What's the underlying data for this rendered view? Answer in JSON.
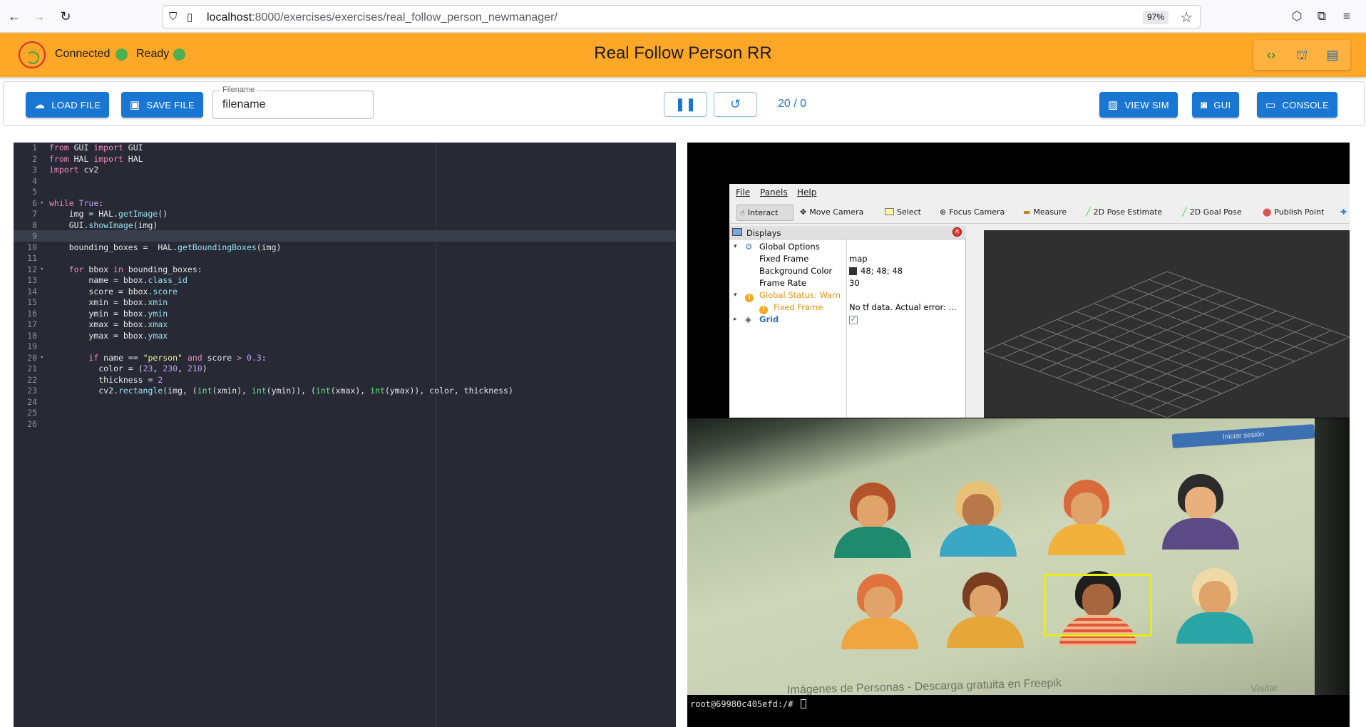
{
  "browser": {
    "url_host": "localhost",
    "url_path": ":8000/exercises/exercises/real_follow_person_newmanager/",
    "zoom": "97%"
  },
  "header": {
    "status_connected": "Connected",
    "status_ready": "Ready",
    "title": "Real Follow Person RR",
    "accent_color": "#ffa726",
    "status_color": "#4caf50"
  },
  "toolbar": {
    "load_label": "LOAD FILE",
    "save_label": "SAVE FILE",
    "filename_label": "Filename",
    "filename_value": "filename",
    "counter": "20 / 0",
    "view_sim_label": "VIEW SIM",
    "gui_label": "GUI",
    "console_label": "CONSOLE",
    "button_color": "#1976d2"
  },
  "editor": {
    "lines": [
      {
        "n": "1",
        "fold": "",
        "html": "<span class=\"kw\">from</span> GUI <span class=\"kw\">import</span> GUI"
      },
      {
        "n": "2",
        "fold": "",
        "html": "<span class=\"kw\">from</span> HAL <span class=\"kw\">import</span> HAL"
      },
      {
        "n": "3",
        "fold": "",
        "html": "<span class=\"kw\">import</span> cv2"
      },
      {
        "n": "4",
        "fold": "",
        "html": ""
      },
      {
        "n": "5",
        "fold": "",
        "html": ""
      },
      {
        "n": "6",
        "fold": "▾",
        "html": "<span class=\"kw\">while</span> <span class=\"num\">True</span>:"
      },
      {
        "n": "7",
        "fold": "",
        "html": "    img = HAL.<span class=\"at\">getImage</span>()"
      },
      {
        "n": "8",
        "fold": "",
        "html": "    GUI.<span class=\"at\">showImage</span>(img)"
      },
      {
        "n": "9",
        "fold": "",
        "html": ""
      },
      {
        "n": "10",
        "fold": "",
        "html": "    bounding_boxes =  HAL.<span class=\"at\">getBoundingBoxes</span>(img)"
      },
      {
        "n": "11",
        "fold": "",
        "html": ""
      },
      {
        "n": "12",
        "fold": "▾",
        "html": "    <span class=\"kw\">for</span> bbox <span class=\"kw\">in</span> bounding_boxes:"
      },
      {
        "n": "13",
        "fold": "",
        "html": "        name = bbox.<span class=\"at\">class_id</span>"
      },
      {
        "n": "14",
        "fold": "",
        "html": "        score = bbox.<span class=\"at\">score</span>"
      },
      {
        "n": "15",
        "fold": "",
        "html": "        xmin = bbox.<span class=\"at\">xmin</span>"
      },
      {
        "n": "16",
        "fold": "",
        "html": "        ymin = bbox.<span class=\"at\">ymin</span>"
      },
      {
        "n": "17",
        "fold": "",
        "html": "        xmax = bbox.<span class=\"at\">xmax</span>"
      },
      {
        "n": "18",
        "fold": "",
        "html": "        ymax = bbox.<span class=\"at\">ymax</span>"
      },
      {
        "n": "19",
        "fold": "",
        "html": ""
      },
      {
        "n": "20",
        "fold": "▾",
        "html": "        <span class=\"kw\">if</span> name == <span class=\"str\">\"person\"</span> <span class=\"kw\">and</span> score <span class=\"op\">&gt;</span> <span class=\"num\">0.3</span>:"
      },
      {
        "n": "21",
        "fold": "",
        "html": "          color = (<span class=\"num\">23</span>, <span class=\"num\">230</span>, <span class=\"num\">210</span>)"
      },
      {
        "n": "22",
        "fold": "",
        "html": "          thickness = <span class=\"num\">2</span>"
      },
      {
        "n": "23",
        "fold": "",
        "html": "          cv2.<span class=\"at\">rectangle</span>(img, (<span class=\"fn\">int</span>(xmin), <span class=\"fn\">int</span>(ymin)), (<span class=\"fn\">int</span>(xmax), <span class=\"fn\">int</span>(ymax)), color, thickness)"
      },
      {
        "n": "24",
        "fold": "",
        "html": ""
      },
      {
        "n": "25",
        "fold": "",
        "html": ""
      },
      {
        "n": "26",
        "fold": "",
        "html": ""
      }
    ]
  },
  "rviz": {
    "menu": [
      "File",
      "Panels",
      "Help"
    ],
    "tools": [
      "Interact",
      "Move Camera",
      "Select",
      "Focus Camera",
      "Measure",
      "2D Pose Estimate",
      "2D Goal Pose",
      "Publish Point"
    ],
    "displays_title": "Displays",
    "tree": [
      {
        "key": "Global Options",
        "value": ""
      },
      {
        "key": "Fixed Frame",
        "value": "map"
      },
      {
        "key": "Background Color",
        "value": "48; 48; 48"
      },
      {
        "key": "Frame Rate",
        "value": "30"
      },
      {
        "key": "Global Status: Warn",
        "value": ""
      },
      {
        "key": "Fixed Frame",
        "value": "No tf data.  Actual error: ..."
      },
      {
        "key": "Grid",
        "value": ""
      }
    ]
  },
  "camera": {
    "caption": "Imágenes de Personas - Descarga gratuita en Freepik",
    "button_text": "Iniciar sesión",
    "visit_text": "Visitar"
  },
  "terminal": {
    "prompt": "root@69980c405efd:/# "
  }
}
